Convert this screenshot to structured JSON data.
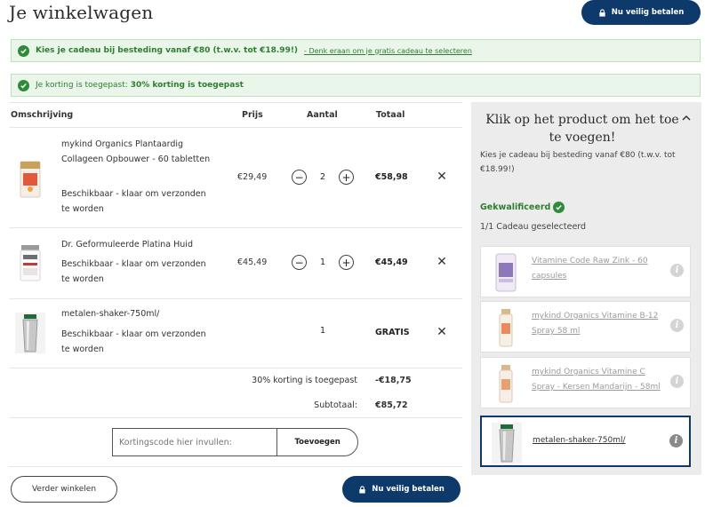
{
  "header": {
    "title": "Je winkelwagen",
    "pay_label": "Nu veilig betalen"
  },
  "banners": {
    "gift_text": "Kies je cadeau bij besteding vanaf €80 (t.w.v. tot €18.99!)",
    "gift_link": "- Denk eraan om je gratis cadeau te selecteren",
    "discount_prefix": "Je korting is toegepast:",
    "discount_text": "30% korting is toegepast"
  },
  "table": {
    "headers": {
      "description": "Omschrijving",
      "price": "Prijs",
      "quantity": "Aantal",
      "total": "Totaal"
    },
    "items": [
      {
        "name": "mykind Organics Plantaardig Collageen Opbouwer - 60 tabletten",
        "status": "Beschikbaar  -  klaar om verzonden te worden",
        "price": "€29,49",
        "qty": "2",
        "total": "€58,98",
        "icon": "collagen-bottle"
      },
      {
        "name": "Dr. Geformuleerde Platina Huid",
        "status": "Beschikbaar  -  klaar om verzonden te worden",
        "price": "€45,49",
        "qty": "1",
        "total": "€45,49",
        "icon": "platinum-bottle"
      },
      {
        "name": "metalen-shaker-750ml/",
        "status": "Beschikbaar  -  klaar om verzonden te worden",
        "price": "",
        "qty": "1",
        "total": "GRATIS",
        "icon": "shaker"
      }
    ],
    "discount_label": "30% korting is toegepast",
    "discount_value": "-€18,75",
    "subtotal_label": "Subtotaal:",
    "subtotal_value": "€85,72"
  },
  "coupon": {
    "placeholder": "Kortingscode hier invullen:",
    "button": "Toevoegen"
  },
  "footer": {
    "continue_label": "Verder winkelen",
    "pay_label": "Nu veilig betalen"
  },
  "gift_panel": {
    "title": "Klik op het product om het toe te voegen!",
    "subtitle": "Kies je cadeau bij besteding vanaf €80 (t.w.v. tot €18.99!)",
    "qualified": "Gekwalificeerd",
    "count": "1/1 Cadeau geselecteerd",
    "items": [
      {
        "name": "Vitamine Code Raw Zink - 60 capsules",
        "selected": false
      },
      {
        "name": "mykind Organics Vitamine B-12 Spray 58 ml",
        "selected": false
      },
      {
        "name": "mykind Organics Vitamine C Spray - Kersen Mandarijn - 58ml",
        "selected": false
      },
      {
        "name": "metalen-shaker-750ml/",
        "selected": true
      }
    ]
  },
  "colors": {
    "accent": "#0e3a6b",
    "success": "#2e8b3a",
    "banner_bg": "#eaf6e9"
  }
}
